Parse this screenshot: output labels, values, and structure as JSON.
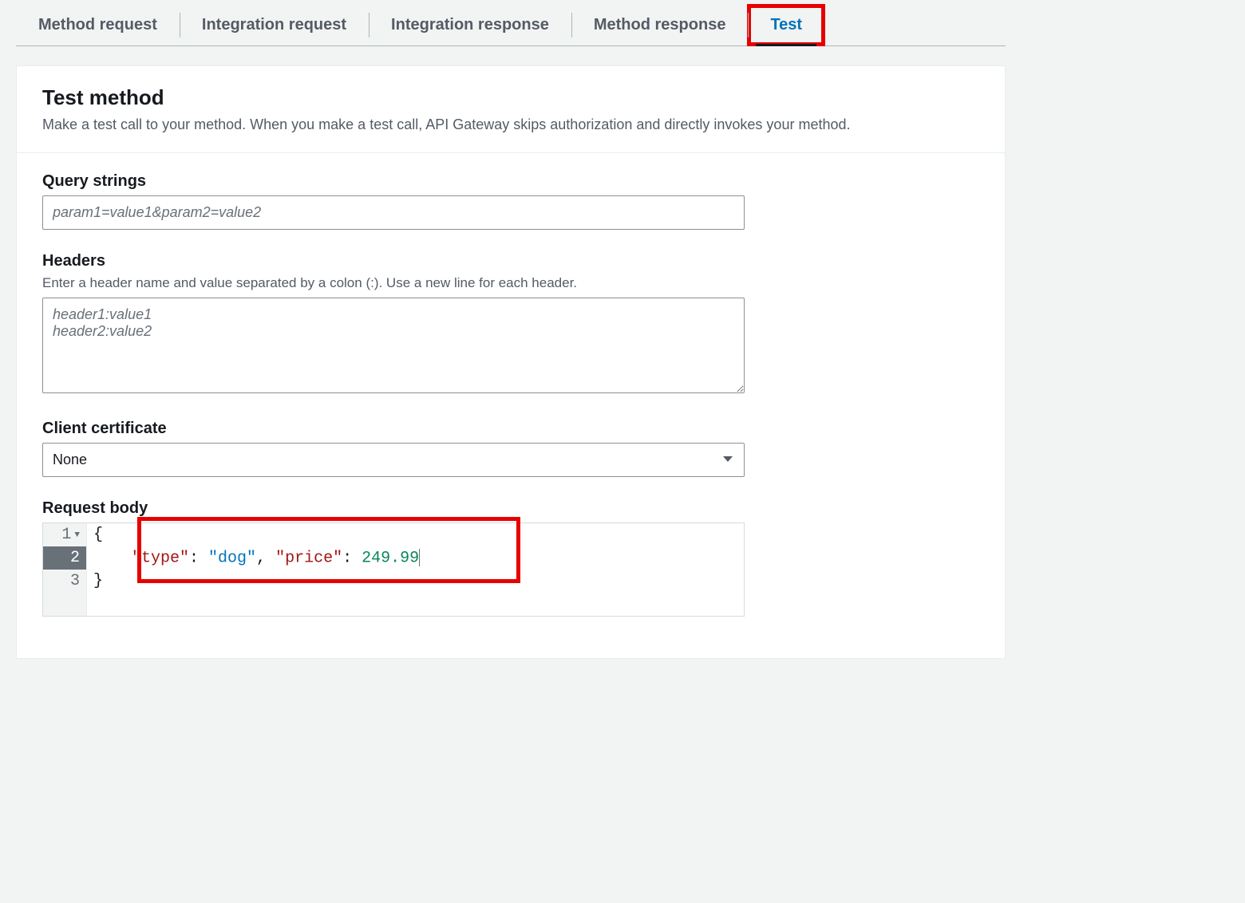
{
  "tabs": {
    "method_request": "Method request",
    "integration_request": "Integration request",
    "integration_response": "Integration response",
    "method_response": "Method response",
    "test": "Test"
  },
  "panel": {
    "title": "Test method",
    "subtitle": "Make a test call to your method. When you make a test call, API Gateway skips authorization and directly invokes your method."
  },
  "query_strings": {
    "label": "Query strings",
    "placeholder": "param1=value1&param2=value2"
  },
  "headers": {
    "label": "Headers",
    "hint": "Enter a header name and value separated by a colon (:). Use a new line for each header.",
    "placeholder": "header1:value1\nheader2:value2"
  },
  "client_cert": {
    "label": "Client certificate",
    "selected": "None"
  },
  "request_body": {
    "label": "Request body",
    "lines": {
      "l1_num": "1",
      "l2_num": "2",
      "l3_num": "3",
      "open_brace": "{",
      "type_key": "\"type\"",
      "colon": ": ",
      "type_val": "\"dog\"",
      "comma": ", ",
      "price_key": "\"price\"",
      "price_val": "249.99",
      "close_brace": "}"
    }
  }
}
